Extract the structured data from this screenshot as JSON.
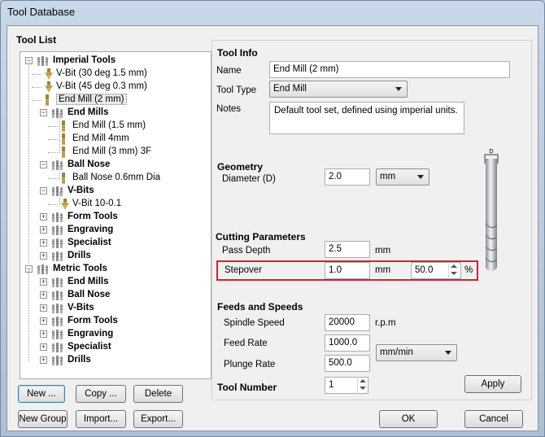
{
  "window": {
    "title": "Tool Database"
  },
  "tool_list": {
    "heading": "Tool List",
    "nodes": [
      {
        "label": "Imperial Tools",
        "bold": true
      },
      {
        "label": "V-Bit (30 deg 1.5 mm)",
        "bold": false
      },
      {
        "label": "V-Bit (45 deg 0.3 mm)",
        "bold": false
      },
      {
        "label": "End Mill (2 mm)",
        "bold": false,
        "selected": true
      },
      {
        "label": "End Mills",
        "bold": true
      },
      {
        "label": "End Mill (1.5 mm)",
        "bold": false
      },
      {
        "label": "End Mill 4mm",
        "bold": false
      },
      {
        "label": "End Mill (3 mm) 3F",
        "bold": false
      },
      {
        "label": "Ball Nose",
        "bold": true
      },
      {
        "label": "Ball Nose 0.6mm Dia",
        "bold": false
      },
      {
        "label": "V-Bits",
        "bold": true
      },
      {
        "label": "V-Bit 10-0.1",
        "bold": false
      },
      {
        "label": "Form Tools",
        "bold": true
      },
      {
        "label": "Engraving",
        "bold": true
      },
      {
        "label": "Specialist",
        "bold": true
      },
      {
        "label": "Drills",
        "bold": true
      },
      {
        "label": "Metric Tools",
        "bold": true
      },
      {
        "label": "End Mills",
        "bold": true
      },
      {
        "label": "Ball Nose",
        "bold": true
      },
      {
        "label": "V-Bits",
        "bold": true
      },
      {
        "label": "Form Tools",
        "bold": true
      },
      {
        "label": "Engraving",
        "bold": true
      },
      {
        "label": "Specialist",
        "bold": true
      },
      {
        "label": "Drills",
        "bold": true
      }
    ],
    "buttons": {
      "new": "New ...",
      "copy": "Copy ...",
      "delete": "Delete",
      "new_group": "New Group",
      "import": "Import...",
      "export": "Export..."
    }
  },
  "tool_info": {
    "heading": "Tool Info",
    "name_label": "Name",
    "name_value": "End Mill (2 mm)",
    "type_label": "Tool Type",
    "type_value": "End Mill",
    "notes_label": "Notes",
    "notes_value": "Default tool set, defined using imperial units."
  },
  "geometry": {
    "heading": "Geometry",
    "diameter_label": "Diameter (D)",
    "diameter_value": "2.0",
    "units_value": "mm",
    "diagram_label": "D"
  },
  "cutting": {
    "heading": "Cutting Parameters",
    "pass_depth_label": "Pass Depth",
    "pass_depth_value": "2.5",
    "pass_depth_unit": "mm",
    "stepover_label": "Stepover",
    "stepover_value": "1.0",
    "stepover_unit": "mm",
    "stepover_percent": "50.0",
    "percent_sign": "%"
  },
  "feeds": {
    "heading": "Feeds and Speeds",
    "spindle_label": "Spindle Speed",
    "spindle_value": "20000",
    "spindle_unit": "r.p.m",
    "feed_label": "Feed Rate",
    "feed_value": "1000.0",
    "plunge_label": "Plunge Rate",
    "plunge_value": "500.0",
    "rate_units": "mm/min"
  },
  "tool_number": {
    "label": "Tool Number",
    "value": "1"
  },
  "actions": {
    "apply": "Apply",
    "ok": "OK",
    "cancel": "Cancel"
  },
  "colors": {
    "highlight": "#d8202a",
    "titlebar": "#c9d8e8"
  }
}
